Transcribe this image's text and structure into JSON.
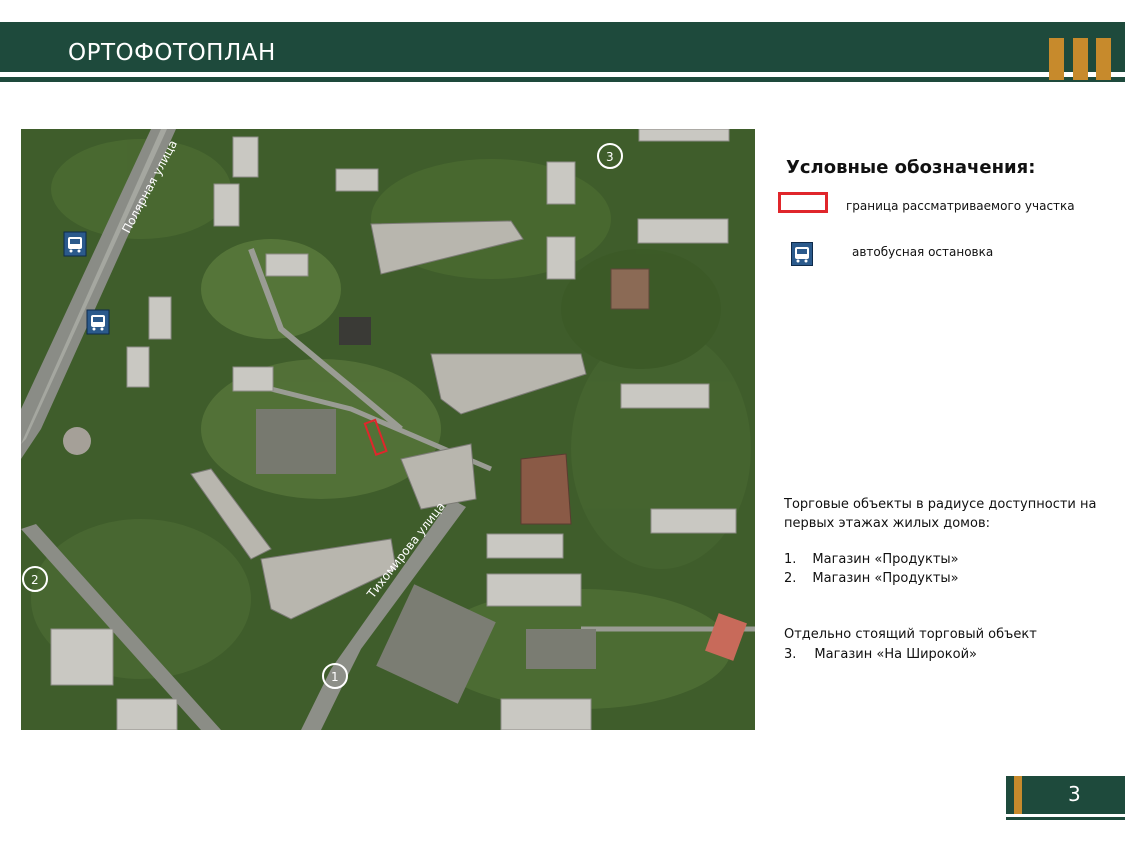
{
  "header": {
    "title": "ОРТОФОТОПЛАН"
  },
  "map": {
    "street_labels": [
      "Полярная улица",
      "Тихомирова улица"
    ],
    "markers": [
      "1",
      "2",
      "3"
    ]
  },
  "legend": {
    "title": "Условные обозначения:",
    "boundary_label": "граница рассматриваемого участка",
    "bus_stop_label": "автобусная остановка"
  },
  "info": {
    "intro_line1": "Торговые объекты в радиусе доступности на",
    "intro_line2": "первых этажах жилых домов:",
    "items": [
      {
        "num": "1.",
        "text": "Магазин «Продукты»"
      },
      {
        "num": "2.",
        "text": "Магазин «Продукты»"
      }
    ],
    "standalone_title": "Отдельно стоящий торговый объект",
    "standalone_item": {
      "num": "3.",
      "text": "Магазин «На Широкой»"
    }
  },
  "footer": {
    "page_number": "3"
  },
  "colors": {
    "brand_green": "#1e4a3c",
    "accent_gold": "#c78a2c",
    "boundary_red": "#e0262b",
    "bus_blue": "#2b5a8c"
  }
}
